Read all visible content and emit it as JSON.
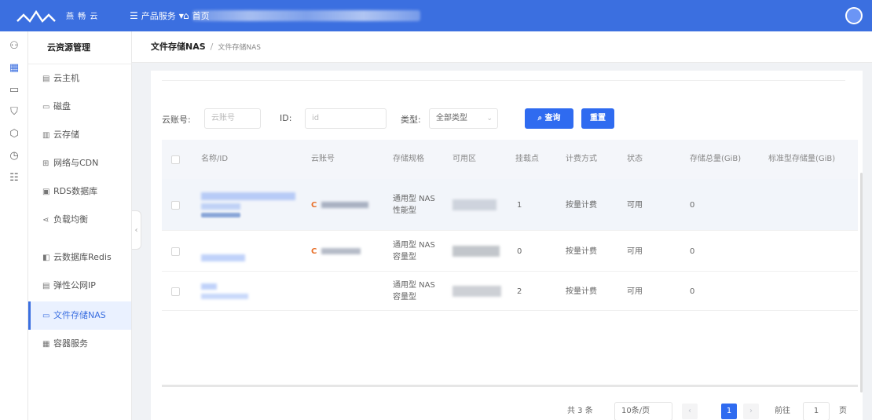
{
  "topbar": {
    "logo_text": "燕 畅 云",
    "menu_products": "产品服务",
    "menu_home": "首页",
    "accent_color": "#3b6fe0"
  },
  "rail_icons": [
    "users-icon",
    "grid-icon",
    "monitor-icon",
    "shield-icon",
    "box-icon",
    "clock-icon",
    "list-icon"
  ],
  "subnav": {
    "title": "云资源管理",
    "items": [
      {
        "icon": "server-icon",
        "label": "云主机"
      },
      {
        "icon": "disk-icon",
        "label": "磁盘"
      },
      {
        "icon": "storage-icon",
        "label": "云存储"
      },
      {
        "icon": "network-icon",
        "label": "网络与CDN"
      },
      {
        "icon": "database-icon",
        "label": "RDS数据库"
      },
      {
        "icon": "share-icon",
        "label": "负载均衡"
      },
      {
        "icon": "redis-icon",
        "label": "云数据库Redis"
      },
      {
        "icon": "ip-icon",
        "label": "弹性公网IP"
      },
      {
        "icon": "nas-icon",
        "label": "文件存储NAS"
      },
      {
        "icon": "container-icon",
        "label": "容器服务"
      }
    ],
    "active_index": 8
  },
  "breadcrumb": {
    "main": "文件存储NAS",
    "separator": "/",
    "sub": "文件存储NAS"
  },
  "filters": {
    "account_label": "云账号:",
    "account_placeholder": "云账号",
    "id_label": "ID:",
    "id_placeholder": "id",
    "type_label": "类型:",
    "type_value": "全部类型",
    "search_button": "查询",
    "reset_button": "重置"
  },
  "table": {
    "columns": [
      "名称/ID",
      "云账号",
      "存储规格",
      "可用区",
      "挂载点",
      "计费方式",
      "状态",
      "存储总量(GiB)",
      "标准型存储量(GiB)"
    ],
    "rows": [
      {
        "name": "",
        "account": "",
        "spec": "通用型 NAS 性能型",
        "zone": "",
        "mount": "1",
        "billing": "按量计费",
        "status": "可用",
        "total": "0"
      },
      {
        "name": "",
        "account": "",
        "spec": "通用型 NAS 容量型",
        "zone": "",
        "mount": "0",
        "billing": "按量计费",
        "status": "可用",
        "total": "0"
      },
      {
        "name": "",
        "account": "",
        "spec": "通用型 NAS 容量型",
        "zone": "",
        "mount": "2",
        "billing": "按量计费",
        "status": "可用",
        "total": "0"
      }
    ]
  },
  "pagination": {
    "total": "共 3 条",
    "page_size": "10条/页",
    "prev": "‹",
    "current": "1",
    "next": "›",
    "goto_label": "前往",
    "goto_value": "1",
    "page_unit": "页"
  }
}
